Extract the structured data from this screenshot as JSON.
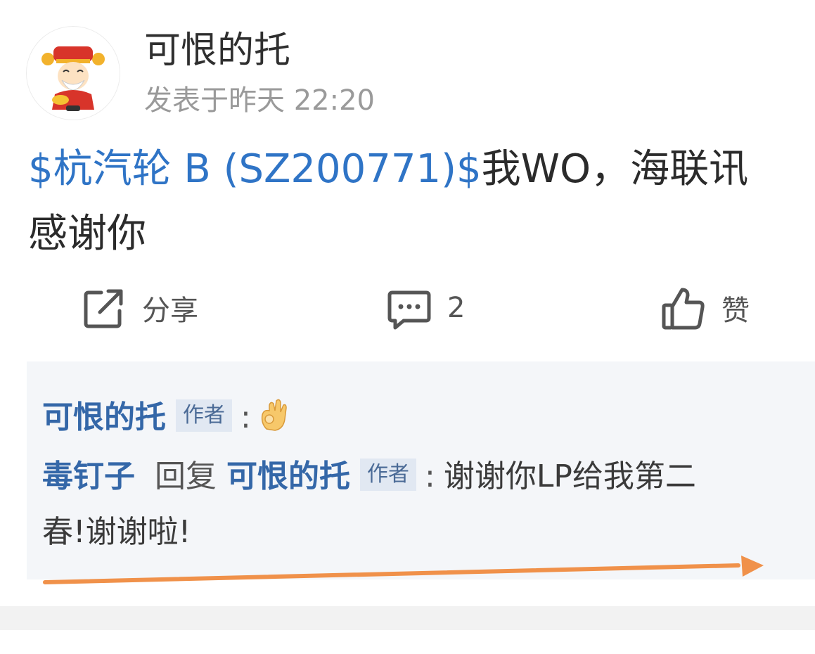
{
  "post": {
    "author": "可恨的托",
    "time": "发表于昨天 22:20",
    "stock_link": "$杭汽轮 B (SZ200771)$",
    "body_text": "我WO，海联讯",
    "body_text_2": "感谢你"
  },
  "actions": {
    "share_label": "分享",
    "comment_count": "2",
    "like_label": "赞"
  },
  "comments": [
    {
      "user": "可恨的托",
      "tag": "作者",
      "colon": ":"
    },
    {
      "user": "毒钉子",
      "reply_word": "回复",
      "reply_to": "可恨的托",
      "tag": "作者",
      "colon": ":",
      "text": "谢谢你LP给我第二",
      "text_2": "春!谢谢啦!"
    }
  ],
  "colors": {
    "link": "#2f74c6",
    "comment_user": "#3467a8",
    "arrow": "#f0914a",
    "comment_bg": "#f4f6f9"
  },
  "icons": {
    "share": "share-icon",
    "comment": "comment-icon",
    "like": "thumbs-up-icon",
    "emoji": "ok-hand-emoji-icon"
  }
}
